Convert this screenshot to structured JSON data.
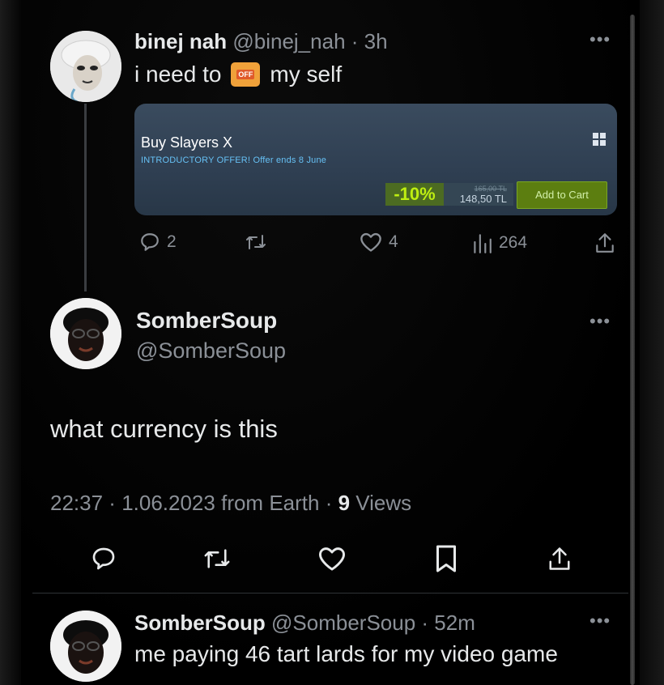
{
  "tweet1": {
    "name": "binej nah",
    "handle": "@binej_nah",
    "time": "3h",
    "text_before": "i need to",
    "emoji_label": "OFF",
    "text_after": "my self",
    "steam": {
      "title": "Buy Slayers X",
      "offer": "INTRODUCTORY OFFER! Offer ends 8 June",
      "discount": "-10%",
      "original_price": "165,00 TL",
      "final_price": "148,50 TL",
      "cart_label": "Add to Cart"
    },
    "replies": "2",
    "likes": "4",
    "views": "264"
  },
  "tweet2": {
    "name": "SomberSoup",
    "handle": "@SomberSoup",
    "body": "what currency is this",
    "time": "22:37",
    "date": "1.06.2023",
    "source": "from Earth",
    "views_count": "9",
    "views_label": "Views"
  },
  "tweet3": {
    "name": "SomberSoup",
    "handle": "@SomberSoup",
    "time": "52m",
    "text": "me paying 46 tart lards for my video game"
  },
  "colors": {
    "background": "#000000",
    "text": "#e7e9ea",
    "muted": "#8b9097",
    "steam_green": "#5c7e10",
    "steam_discount": "#beee11"
  }
}
